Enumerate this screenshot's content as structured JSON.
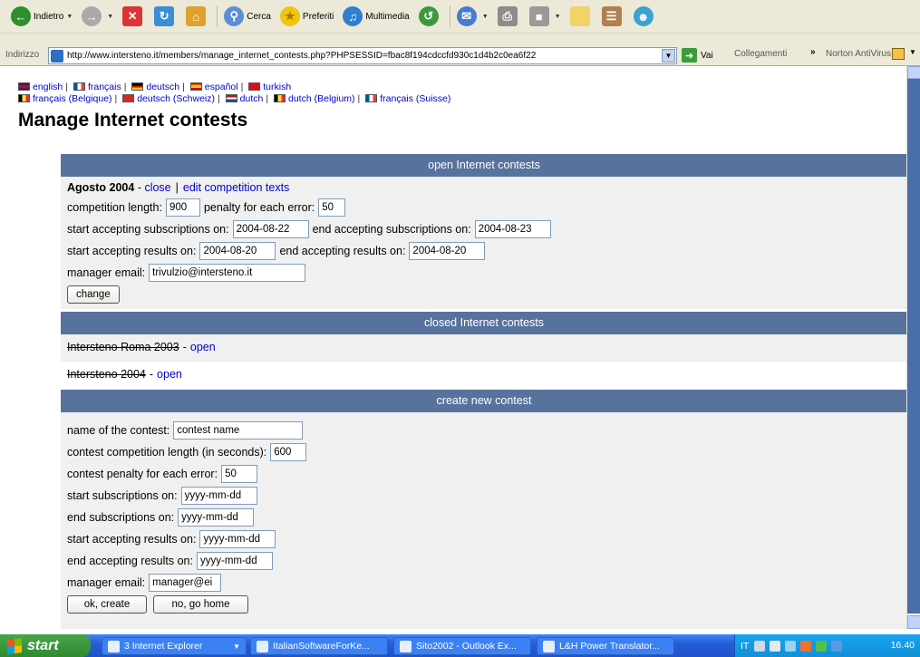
{
  "toolbar": {
    "back_label": "Indietro",
    "search_label": "Cerca",
    "favorites_label": "Preferiti",
    "media_label": "Multimedia"
  },
  "address_bar": {
    "label": "Indirizzo",
    "url": "http://www.intersteno.it/members/manage_internet_contests.php?PHPSESSID=fbac8f194cdccfd930c1d4b2c0ea6f22",
    "go_label": "Vai",
    "links_label": "Collegamenti",
    "norton_label": "Norton AntiVirus"
  },
  "languages": {
    "row1": [
      "english",
      "français",
      "deutsch",
      "español",
      "turkish"
    ],
    "row2": [
      "français (Belgique)",
      "deutsch (Schweiz)",
      "dutch",
      "dutch (Belgium)",
      "français (Suisse)"
    ]
  },
  "page_title": "Manage Internet contests",
  "open_section": {
    "title": "open Internet contests",
    "contest_name": "Agosto 2004",
    "dash": " - ",
    "close_link": "close",
    "pipe": "|",
    "edit_link": "edit competition texts",
    "competition_length_label": "competition length:",
    "competition_length_value": "900",
    "penalty_label": "penalty for each error:",
    "penalty_value": "50",
    "start_subs_label": "start accepting subscriptions on:",
    "start_subs_value": "2004-08-22",
    "end_subs_label": "end accepting subscriptions on:",
    "end_subs_value": "2004-08-23",
    "start_results_label": "start accepting results on:",
    "start_results_value": "2004-08-20",
    "end_results_label": "end accepting results on:",
    "end_results_value": "2004-08-20",
    "email_label": "manager email:",
    "email_value": "trivulzio@intersteno.it",
    "change_button": "change"
  },
  "closed_section": {
    "title": "closed Internet contests",
    "items": [
      {
        "name": "Intersteno Roma 2003",
        "link": "open"
      },
      {
        "name": "Intersteno 2004",
        "link": "open"
      }
    ]
  },
  "create_section": {
    "title": "create new contest",
    "name_label": "name of the contest:",
    "name_value": "contest name",
    "length_label": "contest competition length (in seconds):",
    "length_value": "600",
    "penalty_label": "contest penalty for each error:",
    "penalty_value": "50",
    "start_subs_label": "start subscriptions on:",
    "start_subs_value": "yyyy-mm-dd",
    "end_subs_label": "end subscriptions on:",
    "end_subs_value": "yyyy-mm-dd",
    "start_results_label": "start accepting results on:",
    "start_results_value": "yyyy-mm-dd",
    "end_results_label": "end accepting results on:",
    "end_results_value": "yyyy-mm-dd",
    "email_label": "manager email:",
    "email_value": "manager@ei",
    "ok_button": "ok, create",
    "home_button": "no, go home"
  },
  "taskbar": {
    "start_label": "start",
    "tasks": [
      "3 Internet Explorer",
      "ItalianSoftwareForKe...",
      "Sito2002 - Outlook Ex...",
      "L&H Power Translator..."
    ],
    "tray_lang": "IT",
    "clock": "16.40"
  },
  "colors": {
    "section_header": "#58729e",
    "section_body": "#f0f0f0",
    "link": "#0000cc"
  }
}
